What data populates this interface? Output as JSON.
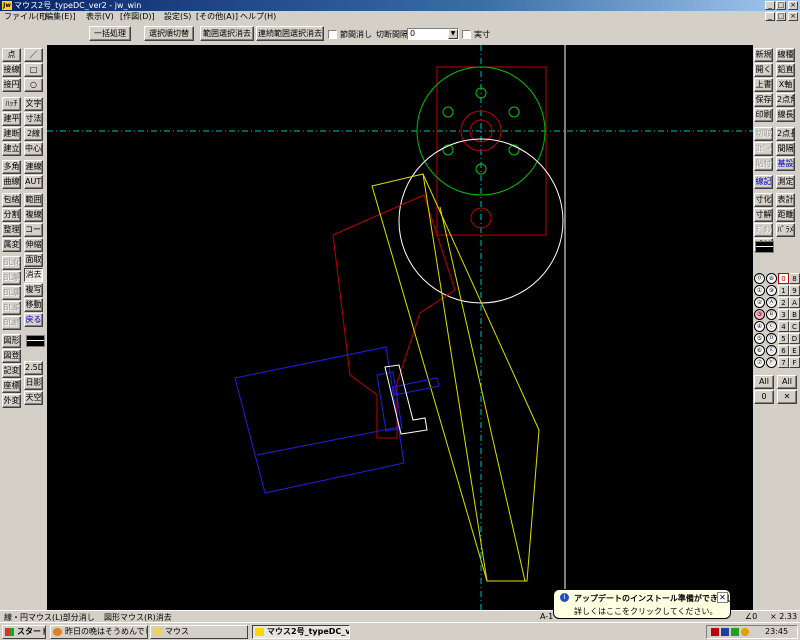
{
  "window": {
    "title": "マウス2号_typeDC_ver2 - jw_win",
    "app_badge": "Jw"
  },
  "menu": [
    "ファイル(F)",
    "[編集(E)]",
    "表示(V)",
    "[作図(D)]",
    "設定(S)",
    "[その他(A)]",
    "ヘルプ(H)"
  ],
  "toolbar": {
    "bulk_process": "一括処理",
    "select_switch": "選択順切替",
    "range_erase": "範囲選択消去",
    "chain_range_erase": "連続範囲選択消去",
    "section_erase_label": "節間消し",
    "cut_interval_label": "切断間隔",
    "cut_interval_value": "0",
    "actual_label": "実寸"
  },
  "left_tools": {
    "col1": [
      "点",
      "接線",
      "接円",
      "ﾊｯﾁ",
      "建平",
      "建断",
      "建立",
      "多角",
      "曲線",
      "包絡",
      "分割",
      "整理",
      "属変",
      "BL化",
      "BL解",
      "BL属",
      "BL編",
      "BL終",
      "図形",
      "図登",
      "記変",
      "座標",
      "外変"
    ],
    "col2": [
      "／",
      "□",
      "○",
      "文字",
      "寸法",
      "2線",
      "中心線",
      "連線",
      "AUTO",
      "範囲",
      "複線",
      "コーナー",
      "伸縮",
      "面取",
      "消去",
      "複写",
      "移動",
      "戻る",
      "2.5D",
      "日影",
      "天空"
    ]
  },
  "right_tools": {
    "col1": [
      "新規",
      "開く",
      "上書",
      "保存",
      "印刷",
      "切取",
      "ｺﾋﾟｰ",
      "貼付",
      "線記",
      "寸化",
      "寸解",
      "ﾃﾞﾀﾝ",
      "式計"
    ],
    "col2": [
      "線種",
      "鉛直",
      "X軸",
      "2点角",
      "線長",
      "2点長",
      "間隔",
      "基設",
      "測定",
      "表計",
      "距離",
      "ﾊﾟﾗﾒ"
    ]
  },
  "layers": {
    "group_left": [
      "⓪",
      "①",
      "②",
      "③",
      "④",
      "⑤",
      "⑥",
      "⑦"
    ],
    "group_right": [
      "⑧",
      "⑨",
      "Ⓐ",
      "Ⓑ",
      "Ⓒ",
      "Ⓓ",
      "Ⓔ",
      "Ⓕ"
    ],
    "group_buttons": [
      "0",
      "1",
      "2",
      "3",
      "4",
      "5",
      "6",
      "7"
    ],
    "group_buttons2": [
      "8",
      "9",
      "A",
      "B",
      "C",
      "D",
      "E",
      "F"
    ],
    "all_label": "All",
    "zero_label": "0"
  },
  "status": {
    "left": "線・円マウス(L)部分消し",
    "mid": "図形マウス(R)消去",
    "paper": "A-1",
    "scale": "∠0",
    "ratio": "× 2.33"
  },
  "taskbar": {
    "start": "スタート",
    "tasks": [
      "昨日の晩はそうめんでした...",
      "マウス",
      "マウス2号_typeDC_ver..."
    ],
    "clock": "23:45"
  },
  "balloon": {
    "title": "アップデートのインストール準備ができました",
    "body": "詳しくはここをクリックしてください。"
  },
  "colors": {
    "canvas": "#000000",
    "green": "#00c000",
    "red": "#c00000",
    "yellow": "#e0e000",
    "blue": "#2020e0",
    "white": "#ffffff",
    "cyan": "#00c0c0"
  }
}
